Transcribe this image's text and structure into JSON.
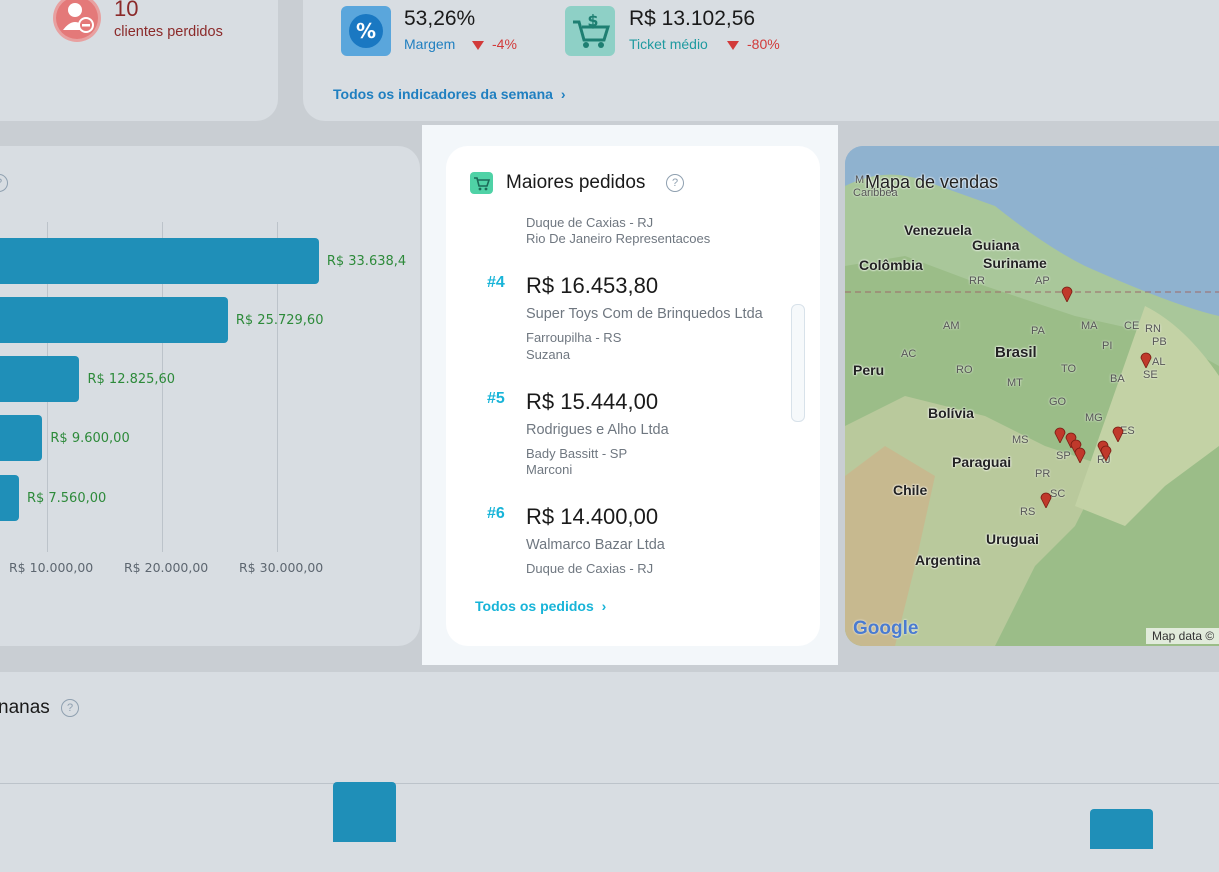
{
  "kpis": {
    "lost_clients_count": "10",
    "lost_clients_label": "clientes perdidos",
    "margin_value": "53,26%",
    "margin_label": "Margem",
    "margin_change": "-4%",
    "ticket_value": "R$ 13.102,56",
    "ticket_label": "Ticket médio",
    "ticket_change": "-80%",
    "all_week_link": "Todos os indicadores da semana",
    "left_fragment": "s"
  },
  "chart_data": {
    "type": "bar",
    "orientation": "horizontal",
    "values": [
      33638.4,
      25729.6,
      12825.6,
      9600.0,
      7560.0
    ],
    "value_labels": [
      "R$ 33.638,4",
      "R$ 25.729,60",
      "R$ 12.825,60",
      "R$ 9.600,00",
      "R$ 7.560,00"
    ],
    "x_ticks": [
      "R$ 10.000,00",
      "R$ 20.000,00",
      "R$ 30.000,00"
    ],
    "x_tick_values": [
      10000,
      20000,
      30000
    ],
    "colors": {
      "bar": "#1f8fb8",
      "label": "#2d8a3a"
    }
  },
  "orders": {
    "title": "Maiores pedidos",
    "partial_top": {
      "location": "Duque de Caxias - RJ",
      "seller": "Rio De Janeiro Representacoes"
    },
    "items": [
      {
        "rank": "#4",
        "value": "R$ 16.453,80",
        "name": "Super Toys Com de Brinquedos Ltda",
        "location": "Farroupilha - RS",
        "seller": "Suzana"
      },
      {
        "rank": "#5",
        "value": "R$ 15.444,00",
        "name": "Rodrigues e Alho Ltda",
        "location": "Bady Bassitt - SP",
        "seller": "Marconi"
      },
      {
        "rank": "#6",
        "value": "R$ 14.400,00",
        "name": "Walmarco Bazar Ltda",
        "location": "Duque de Caxias - RJ",
        "seller": ""
      }
    ],
    "all_link": "Todos os pedidos"
  },
  "map": {
    "title": "Mapa de vendas",
    "labels": [
      "Venezuela",
      "Guiana",
      "Suriname",
      "Colômbia",
      "Brasil",
      "Peru",
      "Bolívia",
      "Paraguai",
      "Chile",
      "Uruguai",
      "Argentina"
    ],
    "states": [
      "RR",
      "AP",
      "AM",
      "PA",
      "MA",
      "CE",
      "RN",
      "PB",
      "PI",
      "AL",
      "AC",
      "RO",
      "TO",
      "SE",
      "BA",
      "MT",
      "GO",
      "MG",
      "ES",
      "MS",
      "SP",
      "RJ",
      "PR",
      "SC",
      "RS"
    ],
    "top_fragment": "M",
    "top_fragment2": "Caribbea",
    "google_logo": "Google",
    "attribution": "Map data ©"
  },
  "bottom": {
    "title_fragment": "nanas"
  },
  "colors": {
    "accent": "#18b4d8",
    "negative": "#d23a3a",
    "lost_red": "#c0392b"
  }
}
